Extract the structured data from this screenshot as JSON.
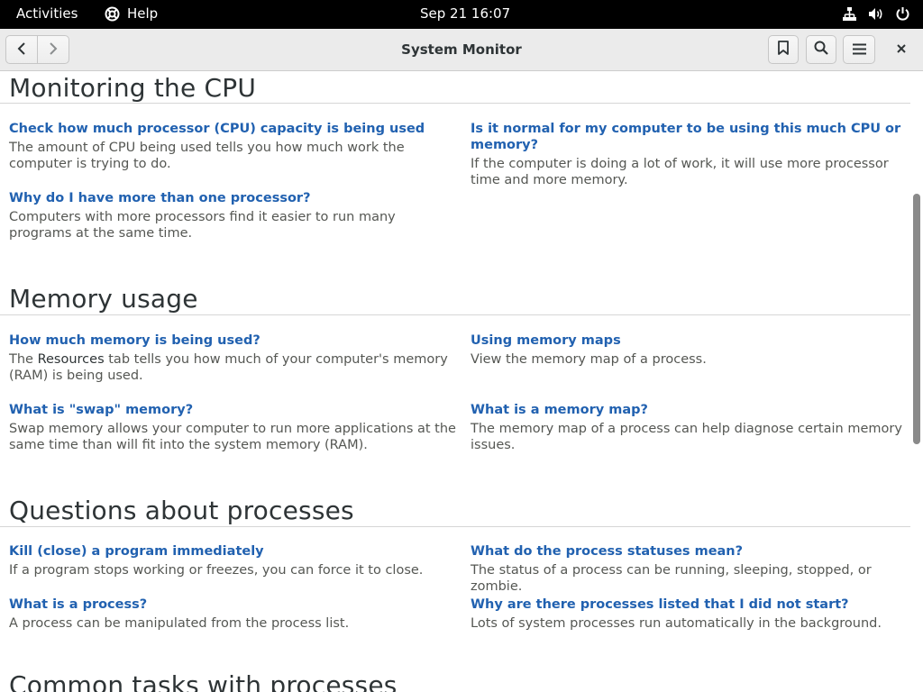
{
  "topbar": {
    "activities": "Activities",
    "app_name": "Help",
    "clock": "Sep 21  16:07"
  },
  "header": {
    "title": "System Monitor"
  },
  "sections": [
    {
      "title": "Monitoring the CPU",
      "items": [
        {
          "title": "Check how much processor (CPU) capacity is being used",
          "desc": "The amount of CPU being used tells you how much work the computer is trying to do."
        },
        {
          "title": "Is it normal for my computer to be using this much CPU or memory?",
          "desc": "If the computer is doing a lot of work, it will use more processor time and more memory."
        },
        {
          "title": "Why do I have more than one processor?",
          "desc": "Computers with more processors find it easier to run many programs at the same time."
        }
      ]
    },
    {
      "title": "Memory usage",
      "items": [
        {
          "title": "How much memory is being used?",
          "desc_before": "The ",
          "desc_keyword": "Resources",
          "desc_after": " tab tells you how much of your computer's memory (RAM) is being used."
        },
        {
          "title": "Using memory maps",
          "desc": "View the memory map of a process."
        },
        {
          "title": "What is \"swap\" memory?",
          "desc": "Swap memory allows your computer to run more applications at the same time than will fit into the system memory (RAM)."
        },
        {
          "title": "What is a memory map?",
          "desc": "The memory map of a process can help diagnose certain memory issues."
        }
      ]
    },
    {
      "title": "Questions about processes",
      "items": [
        {
          "title": "Kill (close) a program immediately",
          "desc": "If a program stops working or freezes, you can force it to close."
        },
        {
          "title": "What do the process statuses mean?",
          "desc": "The status of a process can be running, sleeping, stopped, or zombie."
        },
        {
          "title": "What is a process?",
          "desc": "A process can be manipulated from the process list."
        },
        {
          "title": "Why are there processes listed that I did not start?",
          "desc": "Lots of system processes run automatically in the background."
        }
      ]
    },
    {
      "title": "Common tasks with processes"
    }
  ]
}
